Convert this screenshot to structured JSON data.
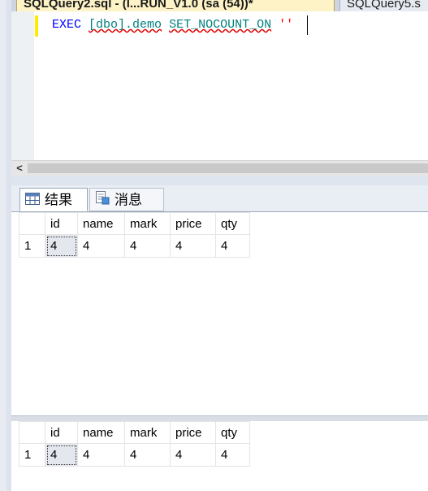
{
  "editor_tabs": [
    {
      "label": "SQLQuery2.sql - (l...RUN_V1.0 (sa (54))*",
      "active": true
    },
    {
      "label": "SQLQuery5.s",
      "active": false
    }
  ],
  "code": {
    "exec": "EXEC",
    "object": "[dbo].demo",
    "set_nocount": "SET_NOCOUNT_ON",
    "string_literal": "''"
  },
  "scrollbar": {
    "left_arrow": "<"
  },
  "results_tabs": [
    {
      "label": "结果",
      "icon": "grid-icon",
      "active": true
    },
    {
      "label": "消息",
      "icon": "messages-icon",
      "active": false
    }
  ],
  "result_sets": [
    {
      "columns": [
        "",
        "id",
        "name",
        "mark",
        "price",
        "qty"
      ],
      "rows": [
        [
          "1",
          "4",
          "4",
          "4",
          "4",
          "4"
        ]
      ]
    },
    {
      "columns": [
        "",
        "id",
        "name",
        "mark",
        "price",
        "qty"
      ],
      "rows": [
        [
          "1",
          "4",
          "4",
          "4",
          "4",
          "4"
        ]
      ]
    }
  ],
  "colors": {
    "keyword": "#0000ff",
    "identifier": "#008080",
    "string": "#ff0000",
    "active_tab": "#fdf3c6",
    "change_marker": "#ffeb00"
  }
}
